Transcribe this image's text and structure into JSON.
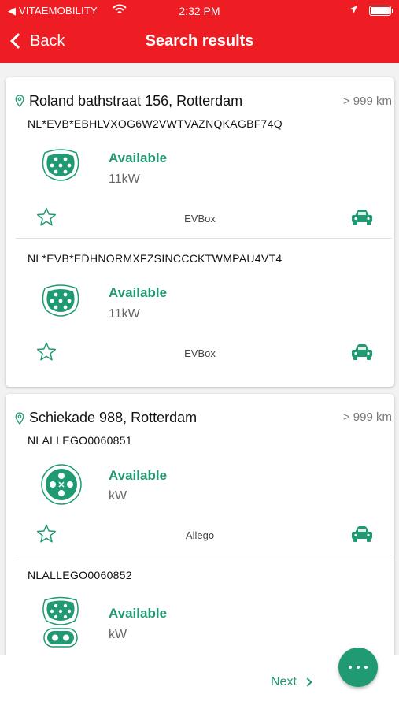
{
  "status_bar": {
    "carrier": "◀ VITAEMOBILITY",
    "time": "2:32 PM"
  },
  "header": {
    "back_label": "Back",
    "title": "Search results"
  },
  "locations": [
    {
      "address": "Roland bathstraat 156, Rotterdam",
      "distance": "> 999 km",
      "chargers": [
        {
          "id": "NL*EVB*EBHLVXOG6W2VWTVAZNQKAGBF74Q",
          "status": "Available",
          "power": "11kW",
          "operator": "EVBox",
          "connector": "type2-icon"
        },
        {
          "id": "NL*EVB*EDHNORMXFZSINCCCKTWMPAU4VT4",
          "status": "Available",
          "power": "11kW",
          "operator": "EVBox",
          "connector": "type2-icon"
        }
      ]
    },
    {
      "address": "Schiekade 988, Rotterdam",
      "distance": "> 999 km",
      "chargers": [
        {
          "id": "NLALLEGO0060851",
          "status": "Available",
          "power": "kW",
          "operator": "Allego",
          "connector": "chademo-icon"
        },
        {
          "id": "NLALLEGO0060852",
          "status": "Available",
          "power": "kW",
          "operator": "",
          "connector": "ccs-icon"
        }
      ]
    }
  ],
  "footer": {
    "next_label": "Next"
  },
  "colors": {
    "header_bg": "#ee1d23",
    "accent": "#1f9a72"
  }
}
